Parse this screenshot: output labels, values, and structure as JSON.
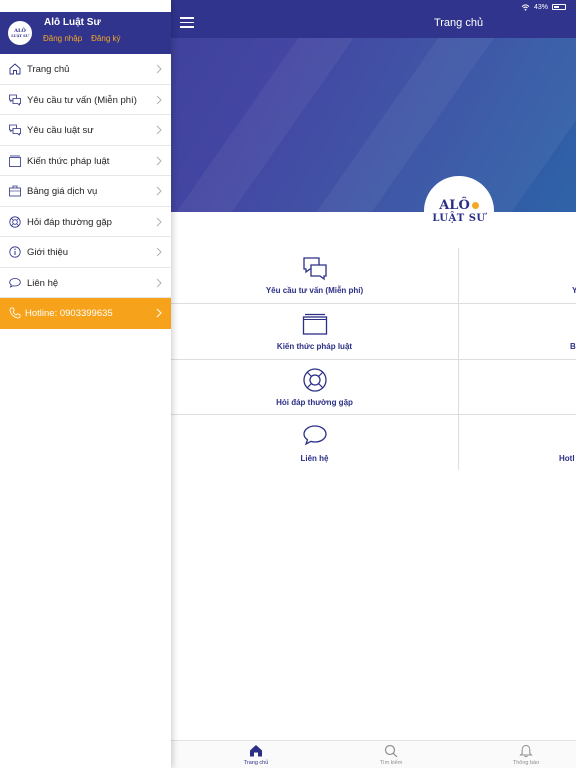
{
  "status_bar": {
    "battery": "43%"
  },
  "nav": {
    "title": "Trang chủ"
  },
  "colors": {
    "brand": "#30348c",
    "accent": "#f7a21b",
    "divider": "#dedede"
  },
  "logo": {
    "top": "ALÔ",
    "bottom": "LUẬT SƯ"
  },
  "grid": {
    "left": [
      {
        "label": "Yêu cầu tư vấn (Miễn phí)",
        "icon": "chat-bubbles-icon"
      },
      {
        "label": "Kiến thức pháp luật",
        "icon": "folder-icon"
      },
      {
        "label": "Hỏi đáp thường gặp",
        "icon": "lifebuoy-icon"
      },
      {
        "label": "Liên hệ",
        "icon": "speech-bubble-icon"
      }
    ],
    "right": [
      {
        "label": "Y"
      },
      {
        "label": "B"
      },
      {
        "label": ""
      },
      {
        "label": "Hotl"
      }
    ]
  },
  "tabs": [
    {
      "label": "Trang chủ",
      "icon": "home-icon"
    },
    {
      "label": "Tìm kiếm",
      "icon": "search-icon"
    },
    {
      "label": "Thông báo",
      "icon": "bell-icon"
    }
  ],
  "drawer": {
    "app_name": "Alô Luật Sư",
    "login": "Đăng nhập",
    "register": "Đăng ký",
    "avatar_top": "ALÔ",
    "avatar_bottom": "LUẬT SƯ",
    "items": [
      {
        "label": "Trang chủ",
        "icon": "home-icon"
      },
      {
        "label": "Yêu cầu tư vấn (Miễn phí)",
        "icon": "chat-bubbles-icon"
      },
      {
        "label": "Yêu cầu luật sư",
        "icon": "chat-bubbles-icon"
      },
      {
        "label": "Kiến thức pháp luật",
        "icon": "folder-icon"
      },
      {
        "label": "Bảng giá dịch vụ",
        "icon": "briefcase-icon"
      },
      {
        "label": "Hỏi đáp thường gặp",
        "icon": "lifebuoy-icon"
      },
      {
        "label": "Giới thiệu",
        "icon": "info-icon"
      },
      {
        "label": "Liên hệ",
        "icon": "speech-bubble-icon"
      },
      {
        "label": "Hotline: 0903399635",
        "icon": "phone-icon"
      }
    ]
  }
}
